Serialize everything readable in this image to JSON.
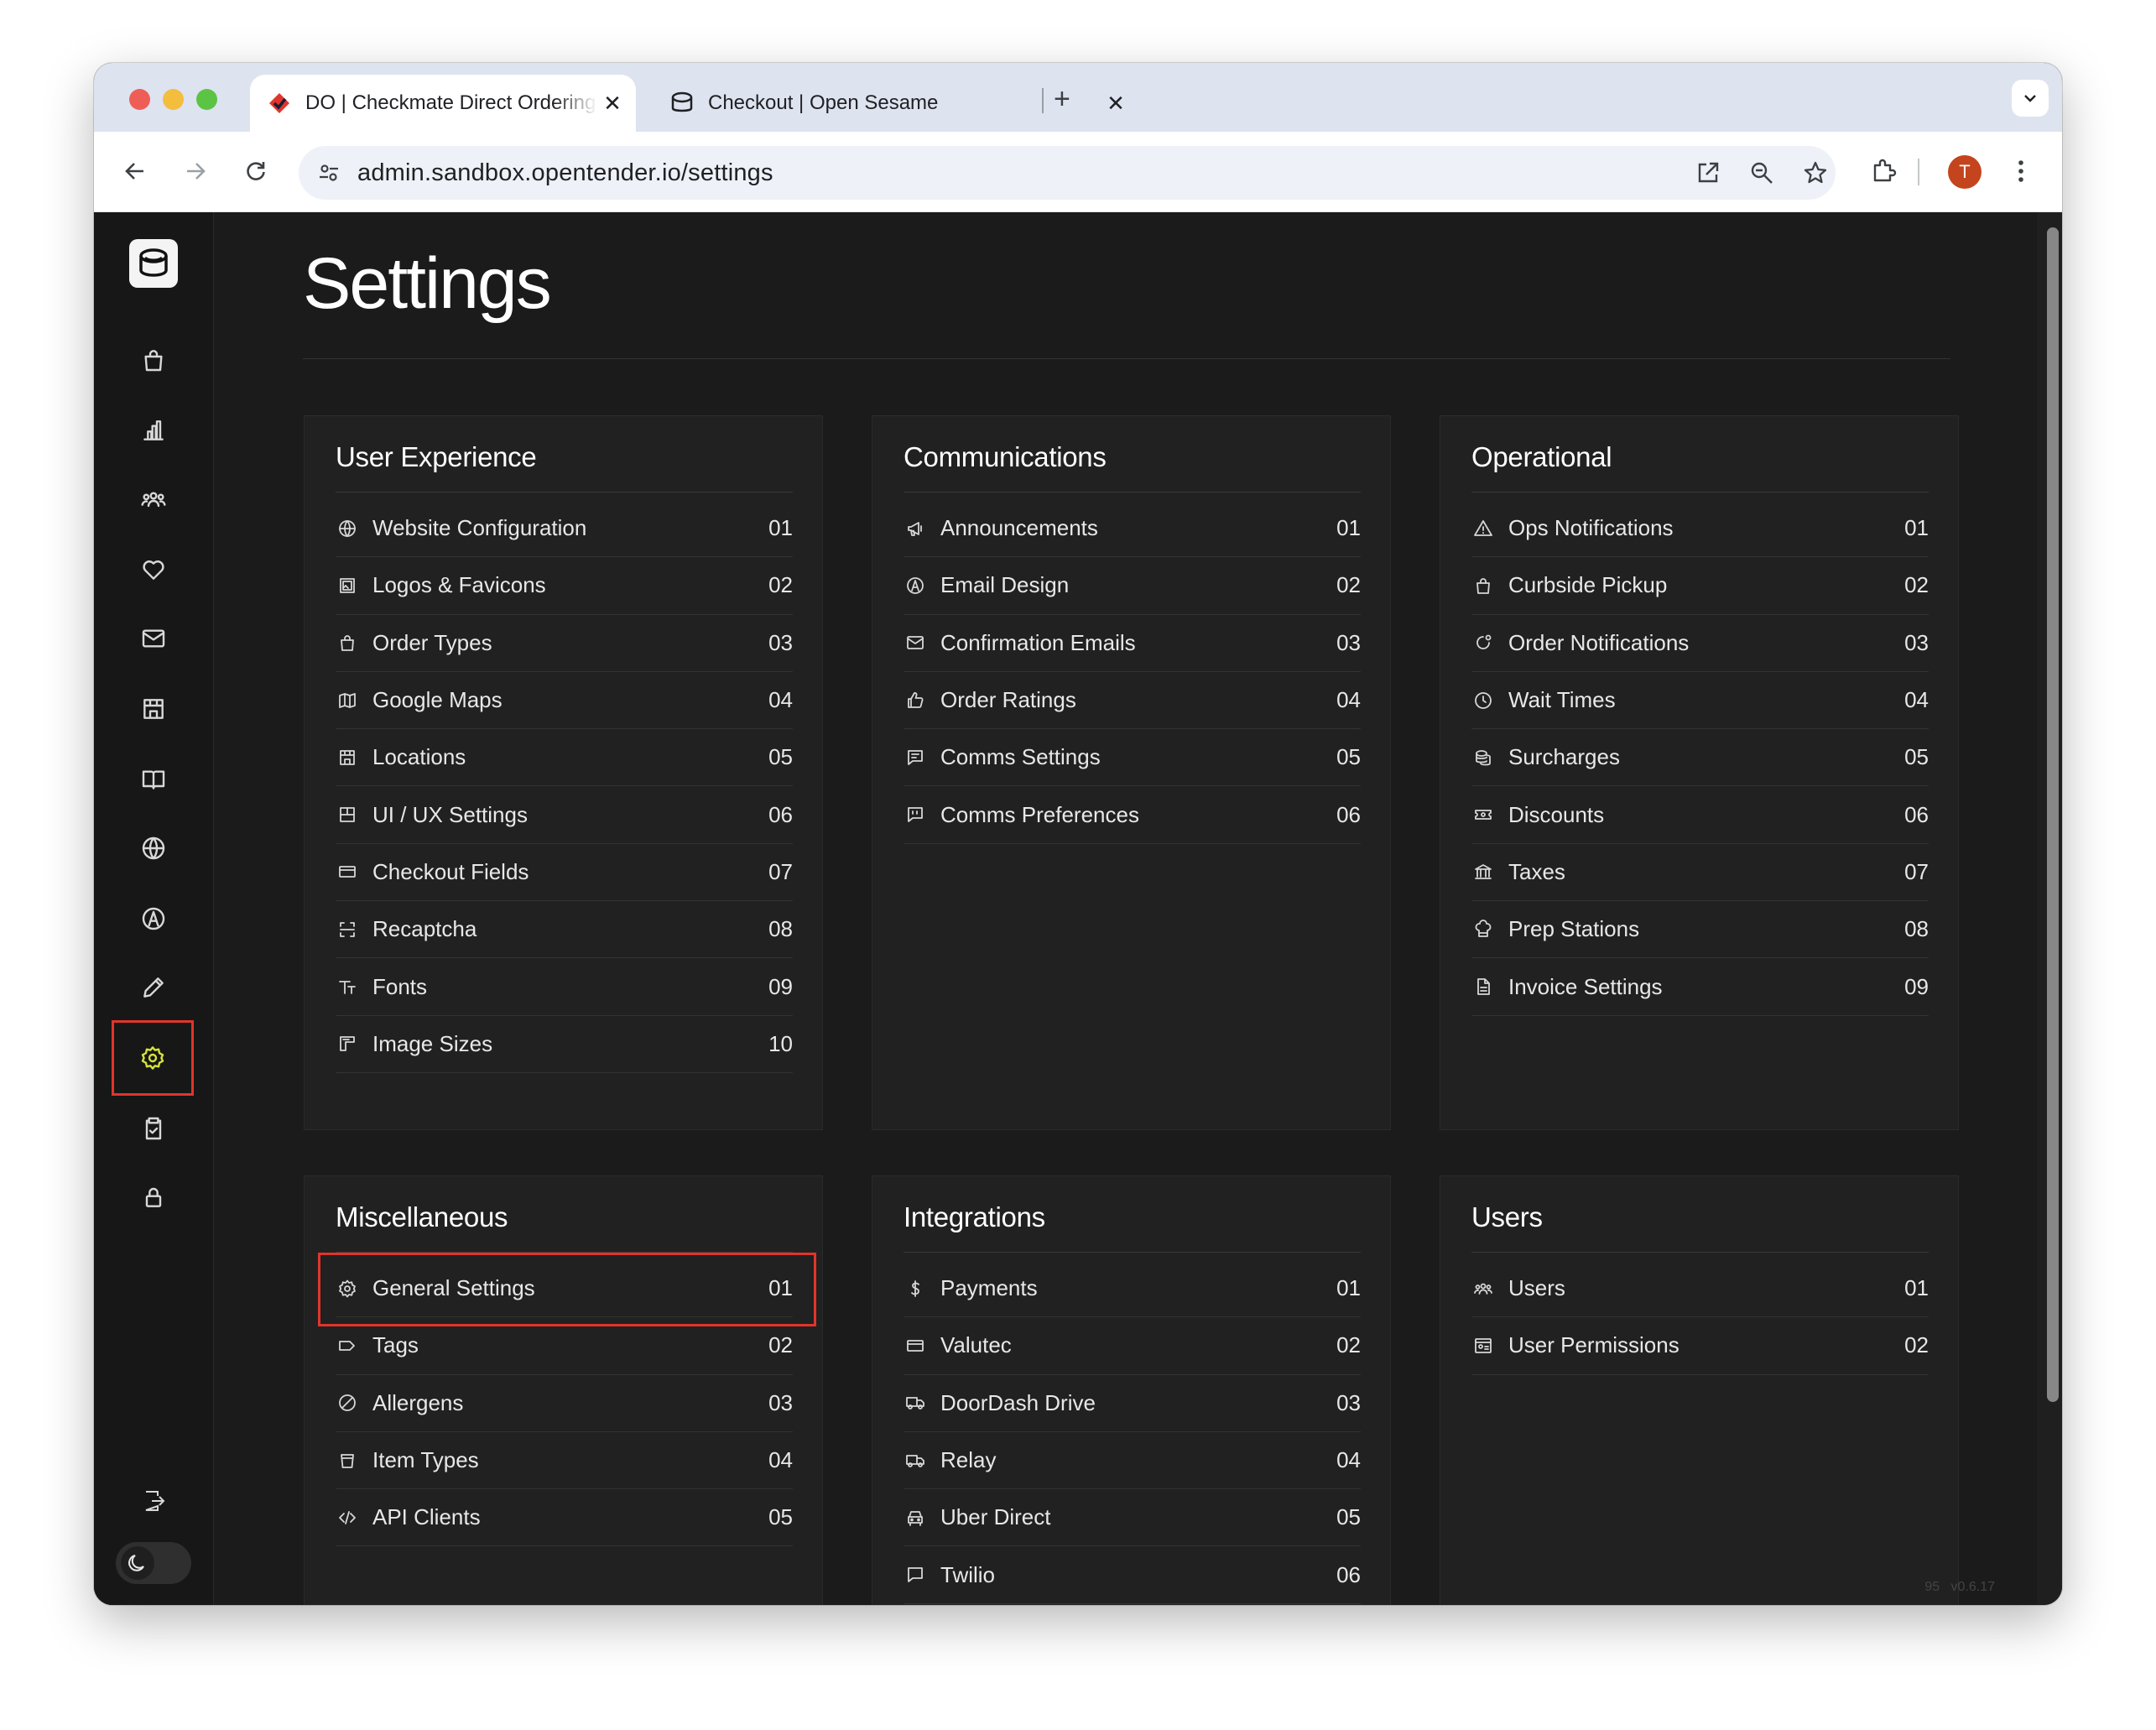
{
  "browser": {
    "tabs": [
      {
        "title": "DO | Checkmate Direct Ordering",
        "active": true
      },
      {
        "title": "Checkout | Open Sesame",
        "active": false
      }
    ],
    "close_glyph": "✕",
    "new_tab_glyph": "+",
    "url": "admin.sandbox.opentender.io/settings",
    "avatar_letter": "T"
  },
  "sidebar": {
    "items": [
      {
        "icon": "shopping-bag-icon"
      },
      {
        "icon": "bar-chart-icon"
      },
      {
        "icon": "users-icon"
      },
      {
        "icon": "heart-icon"
      },
      {
        "icon": "mail-icon"
      },
      {
        "icon": "store-icon"
      },
      {
        "icon": "book-icon"
      },
      {
        "icon": "globe-icon"
      },
      {
        "icon": "design-icon"
      },
      {
        "icon": "pencil-icon"
      },
      {
        "icon": "gear-icon",
        "selected": true
      },
      {
        "icon": "clipboard-icon"
      },
      {
        "icon": "lock-icon"
      }
    ],
    "logout_icon": "logout-icon",
    "theme_icon": "moon-icon",
    "selected_color": "#e0352b",
    "selected_icon_color": "#d6e23a"
  },
  "page": {
    "title": "Settings",
    "version_left": "95",
    "version_right": "v0.6.17"
  },
  "cards": {
    "user_experience": {
      "title": "User Experience",
      "items": [
        {
          "label": "Website Configuration",
          "num": "01",
          "icon": "globe-icon"
        },
        {
          "label": "Logos & Favicons",
          "num": "02",
          "icon": "image-icon"
        },
        {
          "label": "Order Types",
          "num": "03",
          "icon": "shopping-bag-icon"
        },
        {
          "label": "Google Maps",
          "num": "04",
          "icon": "map-icon"
        },
        {
          "label": "Locations",
          "num": "05",
          "icon": "store-icon"
        },
        {
          "label": "UI / UX Settings",
          "num": "06",
          "icon": "layout-icon"
        },
        {
          "label": "Checkout Fields",
          "num": "07",
          "icon": "credit-card-icon"
        },
        {
          "label": "Recaptcha",
          "num": "08",
          "icon": "scan-icon"
        },
        {
          "label": "Fonts",
          "num": "09",
          "icon": "type-icon"
        },
        {
          "label": "Image Sizes",
          "num": "10",
          "icon": "resize-icon"
        }
      ]
    },
    "communications": {
      "title": "Communications",
      "items": [
        {
          "label": "Announcements",
          "num": "01",
          "icon": "megaphone-icon"
        },
        {
          "label": "Email Design",
          "num": "02",
          "icon": "design-icon"
        },
        {
          "label": "Confirmation Emails",
          "num": "03",
          "icon": "mail-icon"
        },
        {
          "label": "Order Ratings",
          "num": "04",
          "icon": "thumbs-up-icon"
        },
        {
          "label": "Comms Settings",
          "num": "05",
          "icon": "message-icon"
        },
        {
          "label": "Comms Preferences",
          "num": "06",
          "icon": "quote-icon"
        }
      ]
    },
    "operational": {
      "title": "Operational",
      "items": [
        {
          "label": "Ops Notifications",
          "num": "01",
          "icon": "alert-triangle-icon"
        },
        {
          "label": "Curbside Pickup",
          "num": "02",
          "icon": "shopping-bag-icon"
        },
        {
          "label": "Order Notifications",
          "num": "03",
          "icon": "notification-icon"
        },
        {
          "label": "Wait Times",
          "num": "04",
          "icon": "clock-icon"
        },
        {
          "label": "Surcharges",
          "num": "05",
          "icon": "coins-icon"
        },
        {
          "label": "Discounts",
          "num": "06",
          "icon": "ticket-icon"
        },
        {
          "label": "Taxes",
          "num": "07",
          "icon": "bank-icon"
        },
        {
          "label": "Prep Stations",
          "num": "08",
          "icon": "chef-icon"
        },
        {
          "label": "Invoice Settings",
          "num": "09",
          "icon": "file-icon"
        }
      ]
    },
    "miscellaneous": {
      "title": "Miscellaneous",
      "items": [
        {
          "label": "General Settings",
          "num": "01",
          "icon": "gear-icon",
          "highlighted": true
        },
        {
          "label": "Tags",
          "num": "02",
          "icon": "tag-icon"
        },
        {
          "label": "Allergens",
          "num": "03",
          "icon": "ban-icon"
        },
        {
          "label": "Item Types",
          "num": "04",
          "icon": "cup-icon"
        },
        {
          "label": "API Clients",
          "num": "05",
          "icon": "code-icon"
        }
      ]
    },
    "integrations": {
      "title": "Integrations",
      "items": [
        {
          "label": "Payments",
          "num": "01",
          "icon": "dollar-icon"
        },
        {
          "label": "Valutec",
          "num": "02",
          "icon": "credit-card-icon"
        },
        {
          "label": "DoorDash Drive",
          "num": "03",
          "icon": "truck-icon"
        },
        {
          "label": "Relay",
          "num": "04",
          "icon": "truck-icon"
        },
        {
          "label": "Uber Direct",
          "num": "05",
          "icon": "car-icon"
        },
        {
          "label": "Twilio",
          "num": "06",
          "icon": "chat-icon"
        }
      ]
    },
    "users": {
      "title": "Users",
      "items": [
        {
          "label": "Users",
          "num": "01",
          "icon": "users-icon"
        },
        {
          "label": "User Permissions",
          "num": "02",
          "icon": "id-card-icon"
        }
      ]
    }
  }
}
